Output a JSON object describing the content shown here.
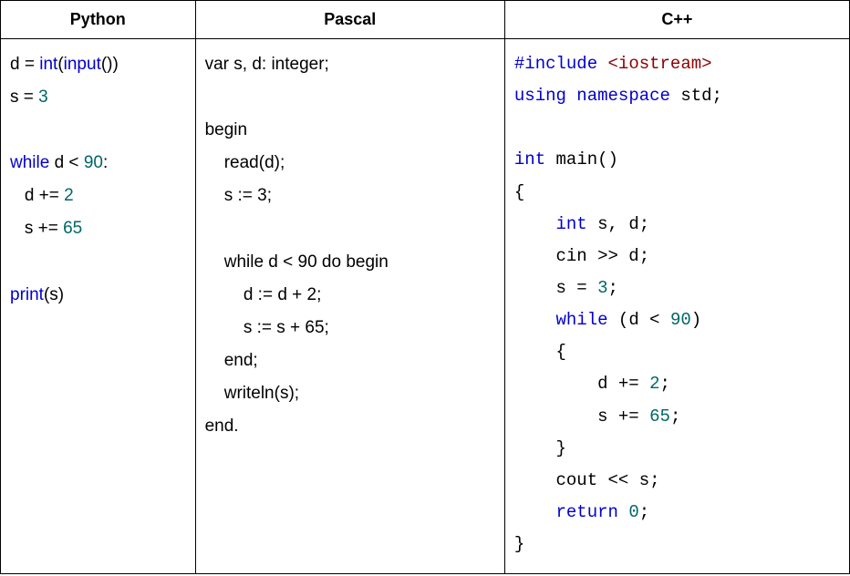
{
  "headers": {
    "python": "Python",
    "pascal": "Pascal",
    "cpp": "C++"
  },
  "code": {
    "python": {
      "line1_a": "d = ",
      "line1_b": "int",
      "line1_c": "(",
      "line1_d": "input",
      "line1_e": "())",
      "line2_a": "s = ",
      "line2_b": "3",
      "line3": "",
      "line4_a": "while",
      "line4_b": " d < ",
      "line4_c": "90",
      "line4_d": ":",
      "line5_a": "   d += ",
      "line5_b": "2",
      "line6_a": "   s += ",
      "line6_b": "65",
      "line7": "",
      "line8_a": "print",
      "line8_b": "(s)"
    },
    "pascal": {
      "l1": "var s, d: integer;",
      "l2": "",
      "l3": "begin",
      "l4": "    read(d);",
      "l5": "    s := 3;",
      "l6": "",
      "l7": "    while d < 90 do begin",
      "l8": "        d := d + 2;",
      "l9": "        s := s + 65;",
      "l10": "    end;",
      "l11": "    writeln(s);",
      "l12": "end."
    },
    "cpp": {
      "l1_a": "#include ",
      "l1_b": "<iostream>",
      "l2_a": "using",
      "l2_b": " namespace",
      "l2_c": " std;",
      "l3": "",
      "l4_a": "int",
      "l4_b": " main()",
      "l5": "{",
      "l6_a": "    int",
      "l6_b": " s, d;",
      "l7": "    cin >> d;",
      "l8_a": "    s = ",
      "l8_b": "3",
      "l8_c": ";",
      "l9_a": "    while",
      "l9_b": " (d < ",
      "l9_c": "90",
      "l9_d": ")",
      "l10": "    {",
      "l11_a": "        d += ",
      "l11_b": "2",
      "l11_c": ";",
      "l12_a": "        s += ",
      "l12_b": "65",
      "l12_c": ";",
      "l13": "    }",
      "l14": "    cout << s;",
      "l15_a": "    return",
      "l15_b": " 0",
      "l15_c": ";",
      "l16": "}"
    }
  }
}
